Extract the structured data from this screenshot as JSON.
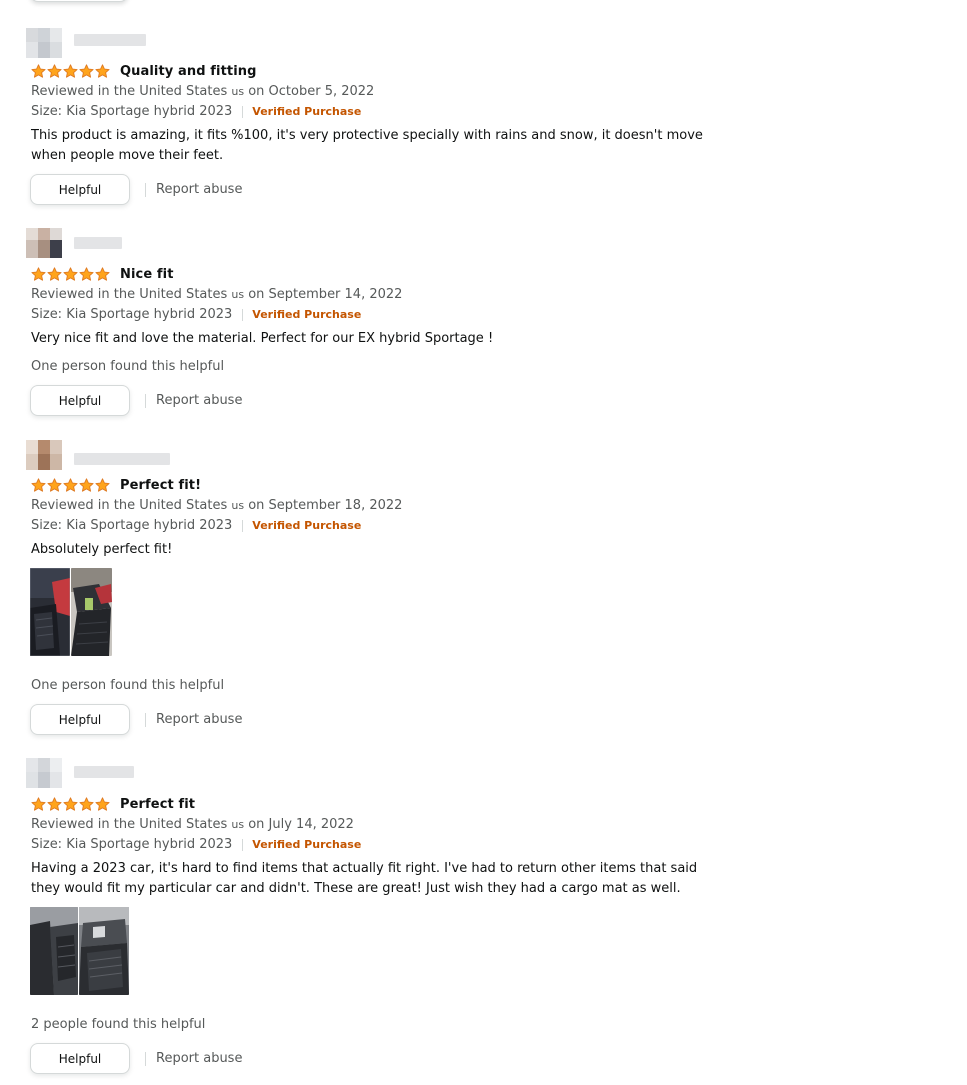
{
  "reviews": [
    {
      "title": "Quality and fitting",
      "meta_prefix": "Reviewed in the United States ",
      "meta_us": "us",
      "meta_date": " on October 5, 2022",
      "size": "Size: Kia Sportage hybrid 2023",
      "verified": "Verified Purchase",
      "body": "This product is amazing, it fits %100, it's very protective specially with rains and snow, it doesn't move when people move their feet.",
      "helpful_count": "",
      "helpful_label": "Helpful",
      "report_label": "Report abuse",
      "rating": 5
    },
    {
      "title": "Nice fit",
      "meta_prefix": "Reviewed in the United States ",
      "meta_us": "us",
      "meta_date": " on September 14, 2022",
      "size": "Size: Kia Sportage hybrid 2023",
      "verified": "Verified Purchase",
      "body": "Very nice fit and love the material. Perfect for our EX hybrid Sportage !",
      "helpful_count": "One person found this helpful",
      "helpful_label": "Helpful",
      "report_label": "Report abuse",
      "rating": 5
    },
    {
      "title": "Perfect fit!",
      "meta_prefix": "Reviewed in the United States ",
      "meta_us": "us",
      "meta_date": " on September 18, 2022",
      "size": "Size: Kia Sportage hybrid 2023",
      "verified": "Verified Purchase",
      "body": "Absolutely perfect fit!",
      "helpful_count": "One person found this helpful",
      "helpful_label": "Helpful",
      "report_label": "Report abuse",
      "rating": 5
    },
    {
      "title": "Perfect fit",
      "meta_prefix": "Reviewed in the United States ",
      "meta_us": "us",
      "meta_date": " on July 14, 2022",
      "size": "Size: Kia Sportage hybrid 2023",
      "verified": "Verified Purchase",
      "body": "Having a 2023 car, it's hard to find items that actually fit right. I've had to return other items that said they would fit my particular car and didn't. These are great! Just wish they had a cargo mat as well.",
      "helpful_count": "2 people found this helpful",
      "helpful_label": "Helpful",
      "report_label": "Report abuse",
      "rating": 5
    }
  ],
  "colors": {
    "star": "#ffa41c",
    "star_outline": "#de7921",
    "verified": "#c45500",
    "secondary_text": "#565959",
    "primary_text": "#0f1111",
    "border": "#d5d9d9"
  },
  "icons": {
    "star": "star-icon",
    "avatar": "profile-avatar"
  }
}
